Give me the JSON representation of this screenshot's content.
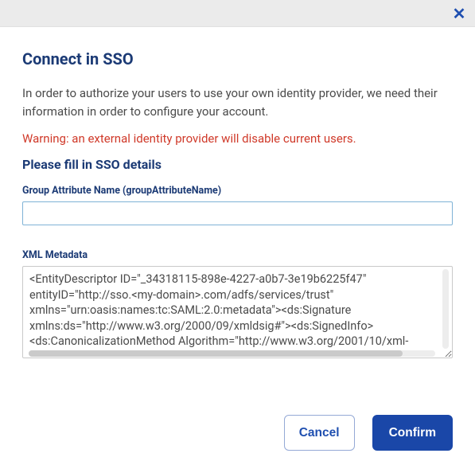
{
  "dialog": {
    "title": "Connect in SSO",
    "description": "In order to authorize your users to use your own identity provider, we need their information in order to configure your account.",
    "warning": "Warning: an external identity provider will disable current users.",
    "subheader": "Please fill in SSO details"
  },
  "fields": {
    "groupAttribute": {
      "label": "Group Attribute Name (groupAttributeName)",
      "value": ""
    },
    "xmlMetadata": {
      "label": "XML Metadata",
      "value": "<EntityDescriptor ID=\"_34318115-898e-4227-a0b7-3e19b6225f47\" entityID=\"http://sso.<my-domain>.com/adfs/services/trust\" xmlns=\"urn:oasis:names:tc:SAML:2.0:metadata\"><ds:Signature xmlns:ds=\"http://www.w3.org/2000/09/xmldsig#\"><ds:SignedInfo><ds:CanonicalizationMethod Algorithm=\"http://www.w3.org/2001/10/xml-"
    }
  },
  "buttons": {
    "cancel": "Cancel",
    "confirm": "Confirm"
  },
  "icons": {
    "close": "✕"
  }
}
